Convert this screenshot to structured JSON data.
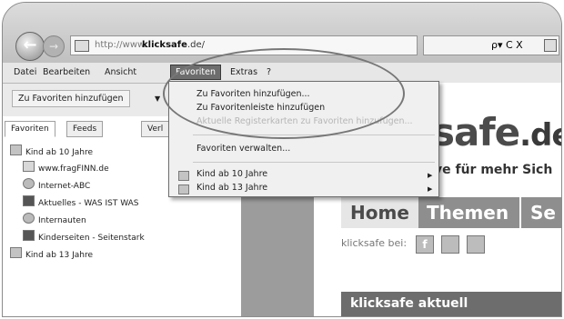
{
  "address": {
    "url_prefix": "http://www.",
    "url_domain": "klicksafe",
    "url_suffix": ".de/",
    "search_controls": "ρ▾ C X"
  },
  "menubar": {
    "items": [
      "Datei",
      "Bearbeiten",
      "Ansicht",
      "Favoriten",
      "Extras",
      "?"
    ]
  },
  "cmdbar": {
    "add_favorites": "Zu Favoriten hinzufügen"
  },
  "dropdown": {
    "item1": "Zu Favoriten hinzufügen...",
    "item2": "Zu Favoritenleiste hinzufügen",
    "item3": "Aktuelle Registerkarten zu Favoriten hinzufügen...",
    "item4": "Favoriten verwalten...",
    "folder1": "Kind ab 10 Jahre",
    "folder2": "Kind ab 13 Jahre"
  },
  "favpane": {
    "tabs": [
      "Favoriten",
      "Feeds",
      "Verl"
    ],
    "items": [
      "Kind ab 10 Jahre",
      "www.fragFINN.de",
      "Internet-ABC",
      "Aktuelles - WAS IST WAS",
      "Internauten",
      "Kinderseiten - Seitenstark",
      "Kind ab 13 Jahre"
    ]
  },
  "page": {
    "logo_main": "safe",
    "logo_tld": ".de",
    "tagline": "ve für mehr Sich",
    "nav_home": "Home",
    "nav_themen": "Themen",
    "nav_more": "Se",
    "social_label": "klicksafe bei:",
    "aktuell": "klicksafe aktuell"
  }
}
